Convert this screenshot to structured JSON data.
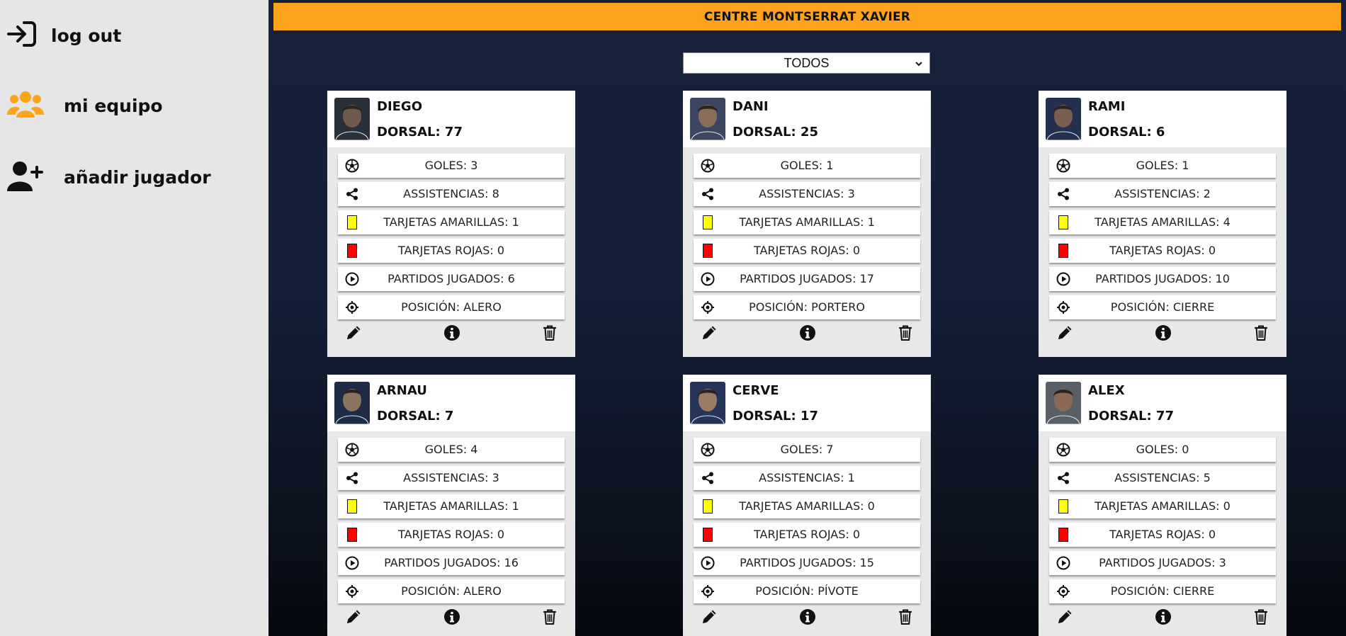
{
  "sidebar": {
    "logout_label": "log out",
    "team_label": "mi equipo",
    "add_player_label": "añadir jugador",
    "accent_color": "#fba41c"
  },
  "header": {
    "team_name": "CENTRE MONTSERRAT XAVIER"
  },
  "filter": {
    "selected": "TODOS"
  },
  "players": [
    {
      "name": "DIEGO",
      "dorsal": "DORSAL: 77",
      "goles": "GOLES: 3",
      "asistencias": "ASSISTENCIAS: 8",
      "amarillas": "TARJETAS AMARILLAS: 1",
      "rojas": "TARJETAS ROJAS: 0",
      "partidos": "PARTIDOS JUGADOS: 6",
      "posicion": "POSICIÓN: ALERO"
    },
    {
      "name": "DANI",
      "dorsal": "DORSAL: 25",
      "goles": "GOLES: 1",
      "asistencias": "ASSISTENCIAS: 3",
      "amarillas": "TARJETAS AMARILLAS: 1",
      "rojas": "TARJETAS ROJAS: 0",
      "partidos": "PARTIDOS JUGADOS: 17",
      "posicion": "POSICIÓN: PORTERO"
    },
    {
      "name": "RAMI",
      "dorsal": "DORSAL: 6",
      "goles": "GOLES: 1",
      "asistencias": "ASSISTENCIAS: 2",
      "amarillas": "TARJETAS AMARILLAS: 4",
      "rojas": "TARJETAS ROJAS: 0",
      "partidos": "PARTIDOS JUGADOS: 10",
      "posicion": "POSICIÓN: CIERRE"
    },
    {
      "name": "ARNAU",
      "dorsal": "DORSAL: 7",
      "goles": "GOLES: 4",
      "asistencias": "ASSISTENCIAS: 3",
      "amarillas": "TARJETAS AMARILLAS: 1",
      "rojas": "TARJETAS ROJAS: 0",
      "partidos": "PARTIDOS JUGADOS: 16",
      "posicion": "POSICIÓN: ALERO"
    },
    {
      "name": "CERVE",
      "dorsal": "DORSAL: 17",
      "goles": "GOLES: 7",
      "asistencias": "ASSISTENCIAS: 1",
      "amarillas": "TARJETAS AMARILLAS: 0",
      "rojas": "TARJETAS ROJAS: 0",
      "partidos": "PARTIDOS JUGADOS: 15",
      "posicion": "POSICIÓN: PÍVOTE"
    },
    {
      "name": "ALEX",
      "dorsal": "DORSAL: 77",
      "goles": "GOLES: 0",
      "asistencias": "ASSISTENCIAS: 5",
      "amarillas": "TARJETAS AMARILLAS: 0",
      "rojas": "TARJETAS ROJAS: 0",
      "partidos": "PARTIDOS JUGADOS: 3",
      "posicion": "POSICIÓN: CIERRE"
    }
  ]
}
